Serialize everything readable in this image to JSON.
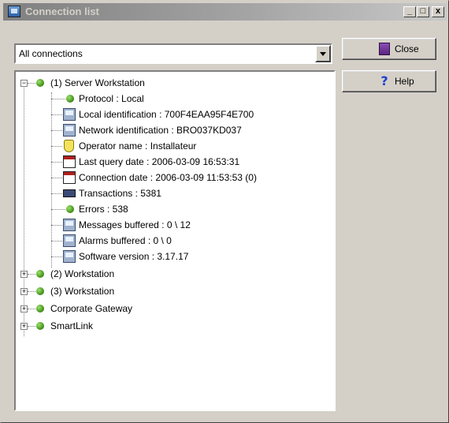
{
  "window": {
    "title": "Connection list"
  },
  "titlebar_buttons": {
    "minimize": "_",
    "maximize": "□",
    "close": "x"
  },
  "filter": {
    "selected": "All connections"
  },
  "buttons": {
    "close_label": "Close",
    "help_label": "Help",
    "help_glyph": "?"
  },
  "tree": {
    "expander_collapse": "−",
    "expander_expand": "+",
    "root": {
      "label": "(1) Server Workstation",
      "icon": "green-status-icon",
      "children": [
        {
          "label": "Protocol : Local",
          "icon": "green-status-icon"
        },
        {
          "label": "Local identification : 700F4EAA95F4E700",
          "icon": "computer-icon"
        },
        {
          "label": "Network identification : BRO037KD037",
          "icon": "computer-icon"
        },
        {
          "label": "Operator name : Installateur",
          "icon": "operator-badge-icon"
        },
        {
          "label": "Last query date : 2006-03-09 16:53:31",
          "icon": "calendar-icon"
        },
        {
          "label": "Connection date : 2006-03-09 11:53:53  (0)",
          "icon": "calendar-icon"
        },
        {
          "label": "Transactions : 5381",
          "icon": "keyboard-icon"
        },
        {
          "label": "Errors : 538",
          "icon": "green-status-icon"
        },
        {
          "label": "Messages buffered : 0 \\ 12",
          "icon": "computer-icon"
        },
        {
          "label": "Alarms buffered : 0 \\ 0",
          "icon": "computer-icon"
        },
        {
          "label": "Software version : 3.17.17",
          "icon": "computer-icon"
        }
      ]
    },
    "collapsed": [
      {
        "label": "(2) Workstation",
        "icon": "green-status-icon"
      },
      {
        "label": "(3) Workstation",
        "icon": "green-status-icon"
      },
      {
        "label": "Corporate Gateway",
        "icon": "green-status-icon"
      },
      {
        "label": "SmartLink",
        "icon": "green-status-icon"
      }
    ]
  }
}
